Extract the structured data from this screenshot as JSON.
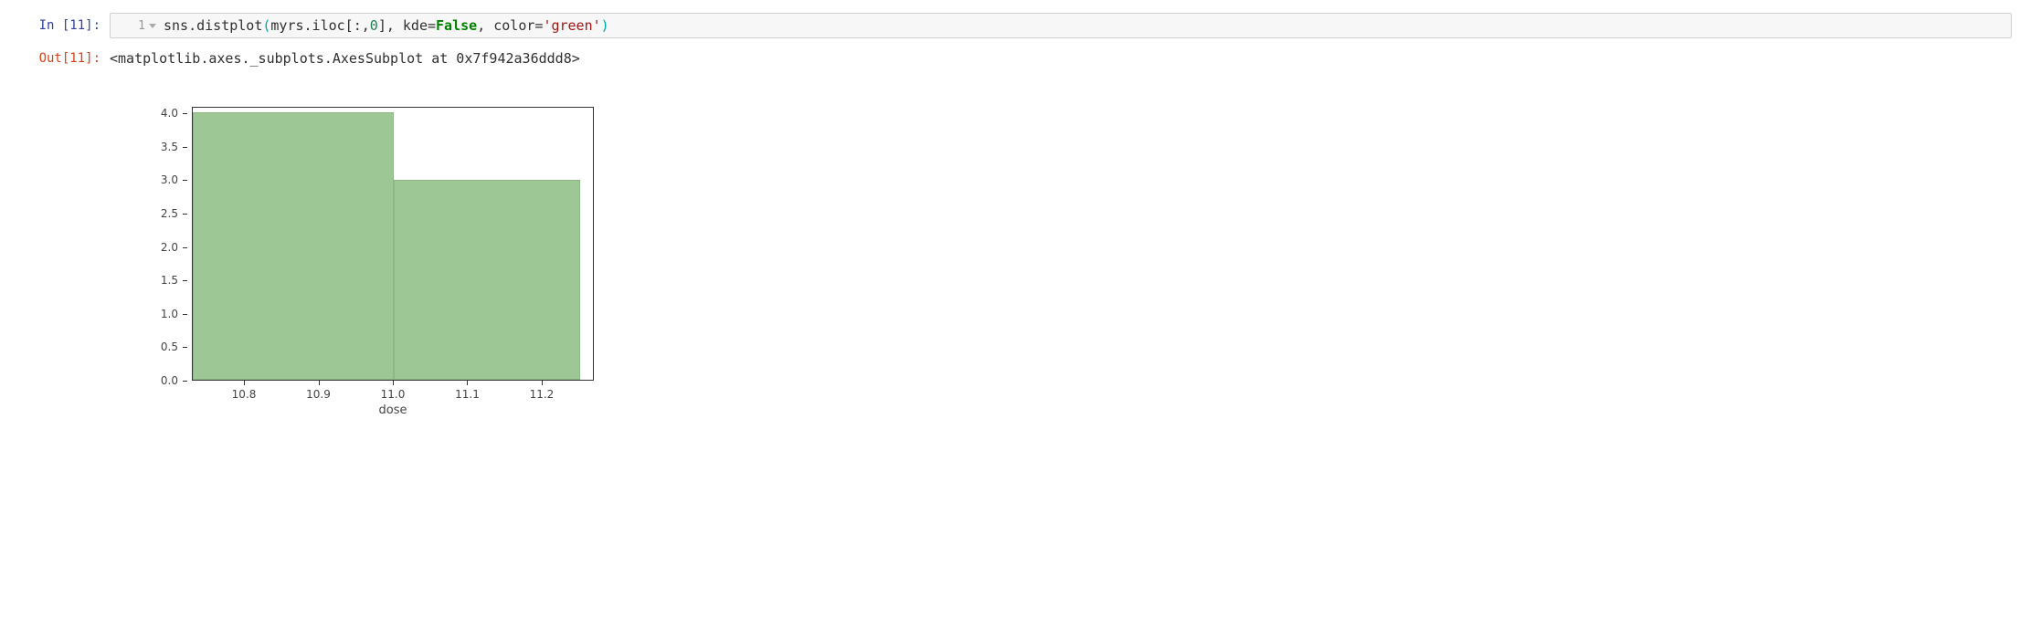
{
  "input_cell": {
    "prompt": "In [11]:",
    "line_num": "1",
    "code": {
      "p0": "sns.distplot",
      "p1": "(",
      "p2": "myrs.iloc[:,",
      "p3": "0",
      "p4": "], kde=",
      "p5": "False",
      "p6": ", color=",
      "p7": "'green'",
      "p8": ")"
    }
  },
  "output_cell": {
    "prompt": "Out[11]:",
    "text": "<matplotlib.axes._subplots.AxesSubplot at 0x7f942a36ddd8>"
  },
  "chart_data": {
    "type": "bar",
    "xlabel": "dose",
    "ylabel": "",
    "xlim": [
      10.73,
      11.27
    ],
    "ylim": [
      0,
      4.1
    ],
    "xticks": [
      10.8,
      10.9,
      11.0,
      11.1,
      11.2
    ],
    "yticks": [
      0.0,
      0.5,
      1.0,
      1.5,
      2.0,
      2.5,
      3.0,
      3.5,
      4.0
    ],
    "bars": [
      {
        "x0": 10.73,
        "x1": 11.0,
        "y": 4
      },
      {
        "x0": 11.0,
        "x1": 11.25,
        "y": 3
      }
    ]
  }
}
